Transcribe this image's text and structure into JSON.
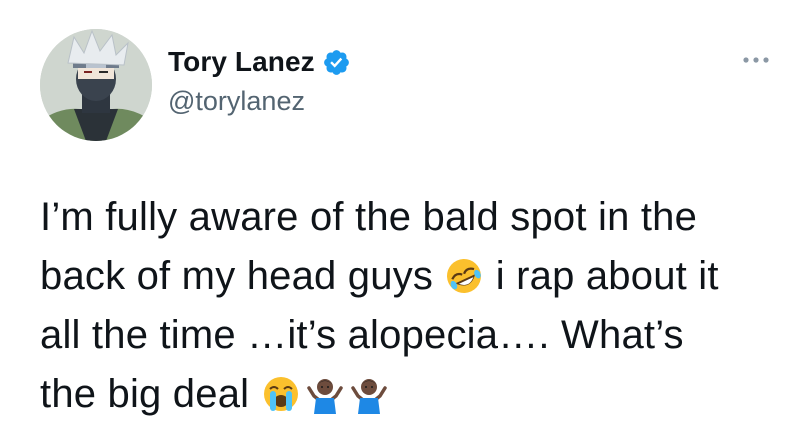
{
  "tweet": {
    "author": {
      "display_name": "Tory Lanez",
      "handle": "@torylanez",
      "verified": true,
      "avatar_icon": "avatar-icon"
    },
    "more_icon": "more-options-icon",
    "text_lines": [
      {
        "text": "I’m fully aware of the bald spot in the"
      },
      {
        "text": "back of my head guys ",
        "emoji_after": "rolling-on-floor-laughing",
        "text_after": " i rap about it"
      },
      {
        "text": "all the time …it’s alopecia…. What’s"
      },
      {
        "text": "the big deal ",
        "emojis": [
          "loudly-crying-face",
          "person-shrugging",
          "person-shrugging"
        ]
      }
    ],
    "colors": {
      "text": "#0f1419",
      "secondary": "#536471",
      "verified": "#1d9bf0"
    }
  }
}
